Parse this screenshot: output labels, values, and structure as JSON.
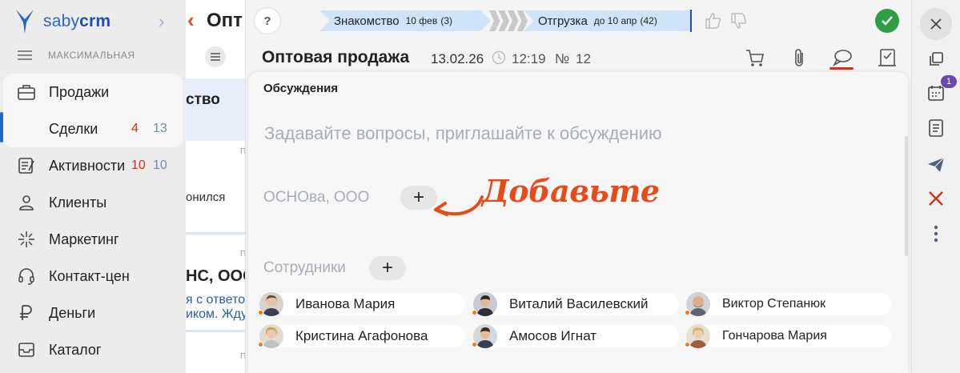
{
  "app": {
    "logo_light": "saby",
    "logo_bold": "crm"
  },
  "sidebar": {
    "mode_label": "МАКСИМАЛЬНАЯ",
    "items": [
      {
        "label": "Продажи",
        "icon": "briefcase-icon"
      },
      {
        "label": "Сделки",
        "count_red": "4",
        "count_blue": "13"
      },
      {
        "label": "Активности",
        "icon": "checklist-icon",
        "count_red": "10",
        "count_blue": "10"
      },
      {
        "label": "Клиенты",
        "icon": "client-icon"
      },
      {
        "label": "Маркетинг",
        "icon": "sparkle-icon"
      },
      {
        "label": "Контакт-центр",
        "icon": "headset-icon"
      },
      {
        "label": "Деньги",
        "icon": "ruble-icon"
      },
      {
        "label": "Каталог",
        "icon": "tray-icon"
      }
    ]
  },
  "list": {
    "title": "Опт",
    "selected_text": "ство",
    "row1_sub": "онился",
    "row2_bold": "НС, ООО",
    "row2_line1": "я с ответо",
    "row2_line2": "иком. Жду",
    "flag": "П"
  },
  "deal": {
    "help": "?",
    "stages": [
      {
        "name": "Знакомство",
        "date": "10 фев",
        "count": "(3)"
      },
      {
        "name": "Отгрузка",
        "date": "до 10 апр",
        "count": "(42)"
      }
    ],
    "title": "Оптовая продажа",
    "date": "13.02.26",
    "time": "12:19",
    "number_label": "№",
    "number": "12"
  },
  "discussion": {
    "section_title": "Обсуждения",
    "placeholder": "Задавайте вопросы, приглашайте к обсуждению",
    "organization": "ОСНОва, ООО",
    "add_symbol": "+",
    "hint": "Добавьте",
    "employees_label": "Сотрудники",
    "employees": [
      {
        "name": "Иванова Мария"
      },
      {
        "name": "Виталий Василевский"
      },
      {
        "name": "Виктор Степанюк"
      },
      {
        "name": "Кристина Агафонова"
      },
      {
        "name": "Амосов Игнат"
      },
      {
        "name": "Гончарова Мария"
      }
    ]
  },
  "right_toolbar": {
    "calendar_badge": "1"
  },
  "colors": {
    "accent": "#2a66c8",
    "hint": "#e84a1a",
    "stage": "#cfe3fb",
    "success": "#2ea043",
    "badge": "#6b49a8"
  }
}
